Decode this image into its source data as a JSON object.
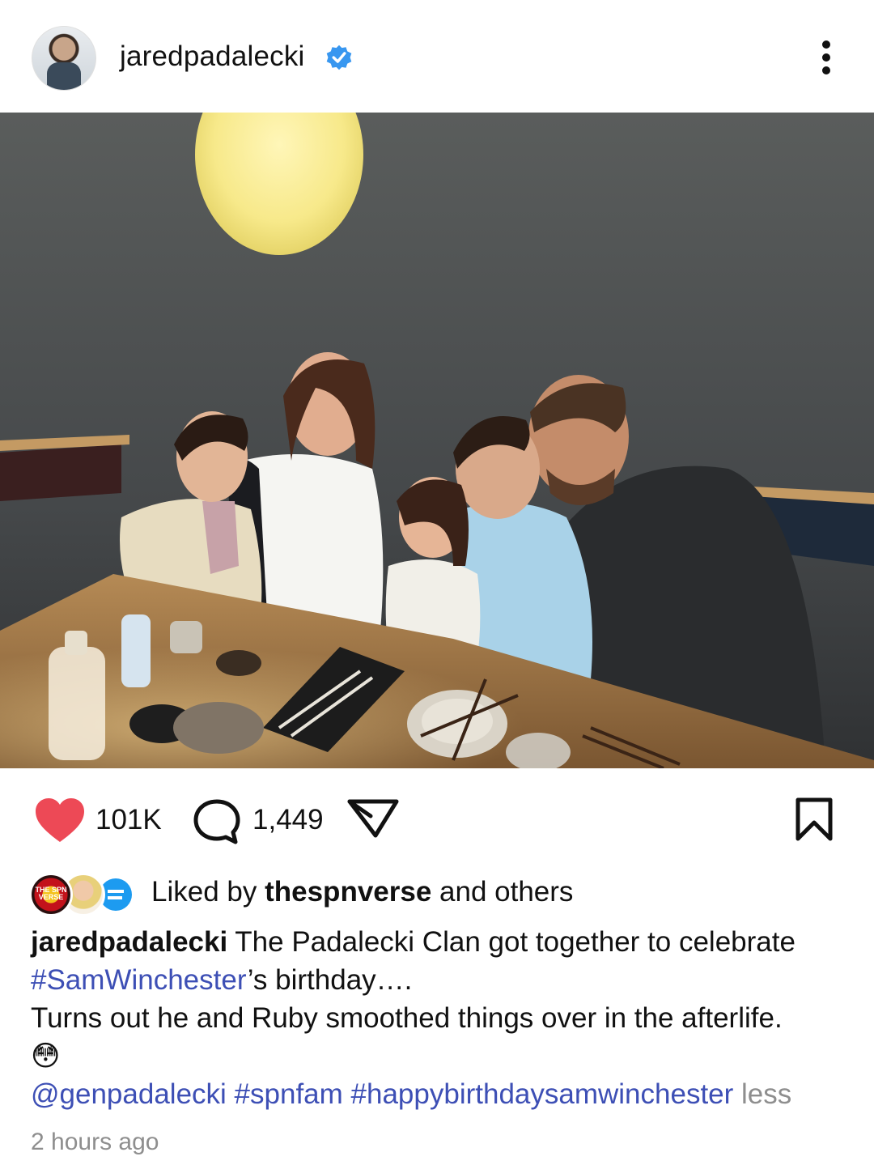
{
  "post": {
    "username": "jaredpadalecki",
    "verified": true,
    "more_icon": "more-vertical-icon"
  },
  "stats": {
    "likes": "101K",
    "comments": "1,449",
    "liked": true
  },
  "liked_by": {
    "prefix": "Liked by ",
    "user": "thespnverse",
    "suffix": " and others",
    "badge_text": "THE SPN VERSE"
  },
  "caption": {
    "username": "jaredpadalecki",
    "text1": " The Padalecki Clan got together to celebrate ",
    "hashtag1": "#SamWinchester",
    "text2": "’s birthday….",
    "line2": "Turns out he and Ruby smoothed things over in the afterlife.",
    "emoji": "😳",
    "mention": "@genpadalecki",
    "hashtag2": "#spnfam",
    "hashtag3": "#happybirthdaysamwinchester",
    "less": "less"
  },
  "timestamp": "2 hours ago",
  "colors": {
    "heart": "#ed4956",
    "verified": "#3897f0",
    "link": "#3d4fb5",
    "muted": "#8e8e8e"
  }
}
